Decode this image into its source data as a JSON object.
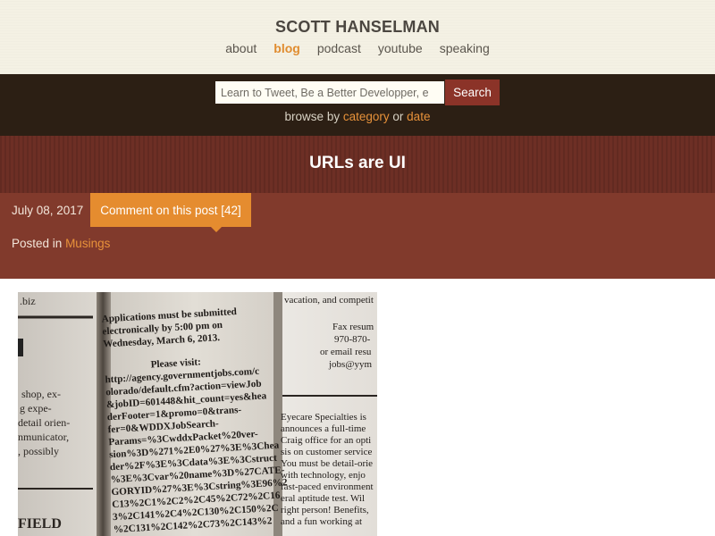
{
  "header": {
    "site_title": "SCOTT HANSELMAN",
    "nav": [
      {
        "label": "about",
        "active": false
      },
      {
        "label": "blog",
        "active": true
      },
      {
        "label": "podcast",
        "active": false
      },
      {
        "label": "youtube",
        "active": false
      },
      {
        "label": "speaking",
        "active": false
      }
    ]
  },
  "search": {
    "value": "Learn to Tweet, Be a Better Developper, e",
    "button_label": "Search",
    "browse_prefix": "browse by",
    "browse_category": "category",
    "browse_or": "or",
    "browse_date": "date"
  },
  "post": {
    "title": "URLs are UI",
    "date": "July 08, 2017",
    "comment_label": "Comment on this post [42]",
    "posted_in_prefix": "Posted in",
    "category": "Musings"
  },
  "image": {
    "left_column": ".biz",
    "left_column_lines": [
      "shop, ex-",
      "g expe-",
      "detail orien-",
      "nmunicator,",
      ", possibly"
    ],
    "left_footer": "FIELD",
    "center_lines": [
      "Applications must be submitted",
      "electronically by 5:00 pm on",
      "Wednesday, March 6, 2013.",
      "Please visit:",
      "http://agency.governmentjobs.com/c",
      "olorado/default.cfm?action=viewJob",
      "&jobID=601448&hit_count=yes&hea",
      "derFooter=1&promo=0&trans-",
      "fer=0&WDDXJobSearch-",
      "Params=%3CwddxPacket%20ver-",
      "sion%3D%271%2E0%27%3E%3Chea",
      "der%2F%3E%3Cdata%3E%3Cstruct",
      "%3E%3Cvar%20name%3D%27CATE-",
      "GORYID%27%3E%3Cstring%3E96%2",
      "C13%2C1%2C2%2C45%2C72%2C16",
      "3%2C141%2C4%2C130%2C150%2C",
      "%2C131%2C142%2C73%2C143%2"
    ],
    "right_lines_top": [
      "vacation, and competit",
      "Fax resum",
      "970-870-",
      "or email resu",
      "jobs@yym"
    ],
    "right_lines_bottom": [
      "Eyecare Specialties is",
      "announces a full-time",
      "Craig office for an opti",
      "sis on customer service",
      "You must be detail-orie",
      "with technology, enjo",
      "fast-paced environment",
      "eral aptitude test. Wil",
      "right person! Benefits,",
      "and a fun working at"
    ]
  }
}
